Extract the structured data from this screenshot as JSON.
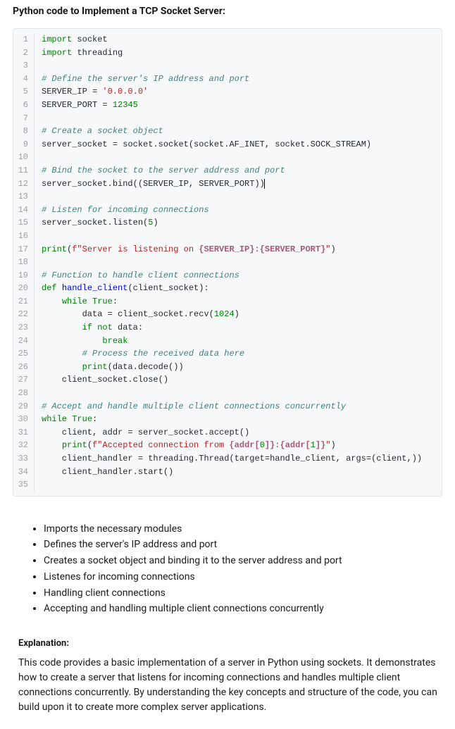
{
  "title": "Python code to Implement a TCP Socket Server:",
  "code": {
    "lines": [
      {
        "n": 1,
        "tokens": [
          {
            "t": "import",
            "c": "kw"
          },
          {
            "t": " socket"
          }
        ]
      },
      {
        "n": 2,
        "tokens": [
          {
            "t": "import",
            "c": "kw"
          },
          {
            "t": " threading"
          }
        ]
      },
      {
        "n": 3,
        "tokens": []
      },
      {
        "n": 4,
        "tokens": [
          {
            "t": "# Define the server's IP address and port",
            "c": "cm"
          }
        ]
      },
      {
        "n": 5,
        "tokens": [
          {
            "t": "SERVER_IP "
          },
          {
            "t": "=",
            "c": "op"
          },
          {
            "t": " "
          },
          {
            "t": "'0.0.0.0'",
            "c": "str"
          }
        ]
      },
      {
        "n": 6,
        "tokens": [
          {
            "t": "SERVER_PORT "
          },
          {
            "t": "=",
            "c": "op"
          },
          {
            "t": " "
          },
          {
            "t": "12345",
            "c": "num"
          }
        ]
      },
      {
        "n": 7,
        "tokens": []
      },
      {
        "n": 8,
        "tokens": [
          {
            "t": "# Create a socket object",
            "c": "cm"
          }
        ]
      },
      {
        "n": 9,
        "tokens": [
          {
            "t": "server_socket "
          },
          {
            "t": "=",
            "c": "op"
          },
          {
            "t": " socket.socket(socket.AF_INET, socket.SOCK_STREAM)"
          }
        ]
      },
      {
        "n": 10,
        "tokens": []
      },
      {
        "n": 11,
        "tokens": [
          {
            "t": "# Bind the socket to the server address and port",
            "c": "cm"
          }
        ]
      },
      {
        "n": 12,
        "tokens": [
          {
            "t": "server_socket.bind((SERVER_IP, SERVER_PORT))"
          },
          {
            "t": "",
            "c": "cursor"
          }
        ]
      },
      {
        "n": 13,
        "tokens": []
      },
      {
        "n": 14,
        "tokens": [
          {
            "t": "# Listen for incoming connections",
            "c": "cm"
          }
        ]
      },
      {
        "n": 15,
        "tokens": [
          {
            "t": "server_socket.listen("
          },
          {
            "t": "5",
            "c": "num"
          },
          {
            "t": ")"
          }
        ]
      },
      {
        "n": 16,
        "tokens": []
      },
      {
        "n": 17,
        "tokens": [
          {
            "t": "print",
            "c": "kw"
          },
          {
            "t": "("
          },
          {
            "t": "f\"Server is listening on ",
            "c": "fstr"
          },
          {
            "t": "{SERVER_IP}",
            "c": "finterp"
          },
          {
            "t": ":",
            "c": "fstr"
          },
          {
            "t": "{SERVER_PORT}",
            "c": "finterp"
          },
          {
            "t": "\"",
            "c": "fstr"
          },
          {
            "t": ")"
          }
        ]
      },
      {
        "n": 18,
        "tokens": []
      },
      {
        "n": 19,
        "tokens": [
          {
            "t": "# Function to handle client connections",
            "c": "cm"
          }
        ]
      },
      {
        "n": 20,
        "tokens": [
          {
            "t": "def",
            "c": "kw"
          },
          {
            "t": " "
          },
          {
            "t": "handle_client",
            "c": "fn"
          },
          {
            "t": "(client_socket):"
          }
        ]
      },
      {
        "n": 21,
        "tokens": [
          {
            "t": "    "
          },
          {
            "t": "while",
            "c": "kw"
          },
          {
            "t": " "
          },
          {
            "t": "True",
            "c": "bool"
          },
          {
            "t": ":"
          }
        ]
      },
      {
        "n": 22,
        "tokens": [
          {
            "t": "        data "
          },
          {
            "t": "=",
            "c": "op"
          },
          {
            "t": " client_socket.recv("
          },
          {
            "t": "1024",
            "c": "num"
          },
          {
            "t": ")"
          }
        ]
      },
      {
        "n": 23,
        "tokens": [
          {
            "t": "        "
          },
          {
            "t": "if",
            "c": "kw"
          },
          {
            "t": " "
          },
          {
            "t": "not",
            "c": "kw"
          },
          {
            "t": " data:"
          }
        ]
      },
      {
        "n": 24,
        "tokens": [
          {
            "t": "            "
          },
          {
            "t": "break",
            "c": "kw"
          }
        ]
      },
      {
        "n": 25,
        "tokens": [
          {
            "t": "        "
          },
          {
            "t": "# Process the received data here",
            "c": "cm"
          }
        ]
      },
      {
        "n": 26,
        "tokens": [
          {
            "t": "        "
          },
          {
            "t": "print",
            "c": "kw"
          },
          {
            "t": "(data.decode())"
          }
        ]
      },
      {
        "n": 27,
        "tokens": [
          {
            "t": "    client_socket.close()"
          }
        ]
      },
      {
        "n": 28,
        "tokens": []
      },
      {
        "n": 29,
        "tokens": [
          {
            "t": "# Accept and handle multiple client connections concurrently",
            "c": "cm"
          }
        ]
      },
      {
        "n": 30,
        "tokens": [
          {
            "t": "while",
            "c": "kw"
          },
          {
            "t": " "
          },
          {
            "t": "True",
            "c": "bool"
          },
          {
            "t": ":"
          }
        ]
      },
      {
        "n": 31,
        "tokens": [
          {
            "t": "    client, addr "
          },
          {
            "t": "=",
            "c": "op"
          },
          {
            "t": " server_socket.accept()"
          }
        ]
      },
      {
        "n": 32,
        "tokens": [
          {
            "t": "    "
          },
          {
            "t": "print",
            "c": "kw"
          },
          {
            "t": "("
          },
          {
            "t": "f\"Accepted connection from ",
            "c": "fstr"
          },
          {
            "t": "{addr[",
            "c": "finterp"
          },
          {
            "t": "0",
            "c": "num"
          },
          {
            "t": "]}",
            "c": "finterp"
          },
          {
            "t": ":",
            "c": "fstr"
          },
          {
            "t": "{addr[",
            "c": "finterp"
          },
          {
            "t": "1",
            "c": "num"
          },
          {
            "t": "]}",
            "c": "finterp"
          },
          {
            "t": "\"",
            "c": "fstr"
          },
          {
            "t": ")"
          }
        ]
      },
      {
        "n": 33,
        "tokens": [
          {
            "t": "    client_handler "
          },
          {
            "t": "=",
            "c": "op"
          },
          {
            "t": " threading.Thread(target"
          },
          {
            "t": "=",
            "c": "op"
          },
          {
            "t": "handle_client, args"
          },
          {
            "t": "=",
            "c": "op"
          },
          {
            "t": "(client,))"
          }
        ]
      },
      {
        "n": 34,
        "tokens": [
          {
            "t": "    client_handler.start()"
          }
        ]
      },
      {
        "n": 35,
        "tokens": []
      }
    ]
  },
  "bullets": [
    "Imports the necessary modules",
    "Defines the server's IP address and port",
    "Creates a socket object and binding it to the server address and port",
    "Listenes for incoming connections",
    "Handling client connections",
    "Accepting and handling multiple client connections concurrently"
  ],
  "explanation": {
    "heading": "Explanation:",
    "body": "This code provides a basic implementation of a server in Python using sockets. It demonstrates how to create a server that listens for incoming connections and handles multiple client connections concurrently. By understanding the key concepts and structure of the code, you can build upon it to create more complex server applications."
  }
}
